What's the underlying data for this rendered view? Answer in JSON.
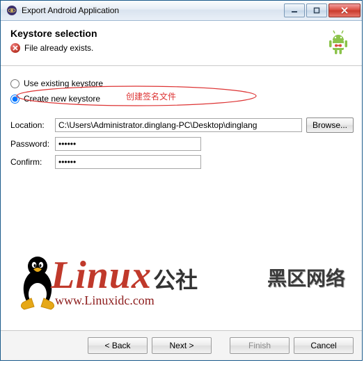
{
  "window": {
    "title": "Export Android Application"
  },
  "header": {
    "title": "Keystore selection",
    "error_msg": "File already exists."
  },
  "radios": {
    "use_existing": "Use existing keystore",
    "create_new": "Create new keystore",
    "selected": "create_new"
  },
  "annotation": {
    "text": "创建签名文件"
  },
  "form": {
    "location_label": "Location:",
    "location_value": "C:\\Users\\Administrator.dinglang-PC\\Desktop\\dinglang",
    "browse_label": "Browse...",
    "password_label": "Password:",
    "password_value": "••••••",
    "confirm_label": "Confirm:",
    "confirm_value": "••••••"
  },
  "buttons": {
    "back": "< Back",
    "next": "Next >",
    "finish": "Finish",
    "cancel": "Cancel"
  },
  "watermark": {
    "brand_big": "Linux",
    "brand_small": "公社",
    "url": "www.Linuxidc.com",
    "cn": "黑区网络"
  }
}
